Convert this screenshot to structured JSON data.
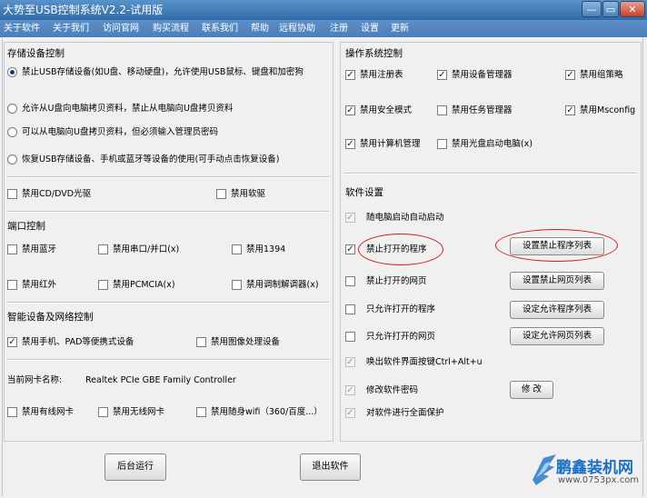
{
  "window": {
    "title": "大势至USB控制系统V2.2-试用版",
    "min_label": "—",
    "max_label": "▭",
    "close_label": "✕"
  },
  "menu": [
    "关于软件",
    "关于我们",
    "访问官网",
    "购买流程",
    "联系我们",
    "帮助",
    "远程协助",
    "注册",
    "设置",
    "更新"
  ],
  "storage": {
    "title": "存储设备控制",
    "radios": [
      {
        "label": "禁止USB存储设备(如U盘、移动硬盘)，允许使用USB鼠标、键盘和加密狗",
        "selected": true
      },
      {
        "label": "允许从U盘向电脑拷贝资料，禁止从电脑向U盘拷贝资料",
        "selected": false
      },
      {
        "label": "可以从电脑向U盘拷贝资料，但必须输入管理员密码",
        "selected": false
      },
      {
        "label": "恢复USB存储设备、手机或蓝牙等设备的使用(可手动点击恢复设备)",
        "selected": false
      }
    ],
    "cd_label": "禁用CD/DVD光驱",
    "floppy_label": "禁用软驱"
  },
  "port": {
    "title": "端口控制",
    "items": [
      "禁用蓝牙",
      "禁用串口/并口(x)",
      "禁用1394",
      "禁用红外",
      "禁用PCMCIA(x)",
      "禁用调制解调器(x)"
    ]
  },
  "smart": {
    "title": "智能设备及网络控制",
    "phone_label": "禁用手机、PAD等便携式设备",
    "image_label": "禁用图像处理设备",
    "nic_label": "当前网卡名称:",
    "nic_value": "Realtek PCIe GBE Family Controller",
    "wired_label": "禁用有线网卡",
    "wireless_label": "禁用无线网卡",
    "wifi_label": "禁用随身wifi（360/百度...）"
  },
  "os": {
    "title": "操作系统控制",
    "items": [
      {
        "label": "禁用注册表",
        "checked": true
      },
      {
        "label": "禁用设备管理器",
        "checked": true
      },
      {
        "label": "禁用组策略",
        "checked": true
      },
      {
        "label": "禁用安全模式",
        "checked": true
      },
      {
        "label": "禁用任务管理器",
        "checked": false
      },
      {
        "label": "禁用Msconfig",
        "checked": true
      },
      {
        "label": "禁用计算机管理",
        "checked": true
      },
      {
        "label": "禁用光盘启动电脑(x)",
        "checked": false
      }
    ]
  },
  "software": {
    "title": "软件设置",
    "items": [
      {
        "label": "随电脑启动自动启动",
        "checked": true
      },
      {
        "label": "禁止打开的程序",
        "checked": true
      },
      {
        "label": "禁止打开的网页",
        "checked": false
      },
      {
        "label": "只允许打开的程序",
        "checked": false
      },
      {
        "label": "只允许打开的网页",
        "checked": false
      },
      {
        "label": "唤出软件界面按键Ctrl+Alt+u",
        "checked": true
      },
      {
        "label": "修改软件密码",
        "checked": true
      },
      {
        "label": "对软件进行全面保护",
        "checked": true
      }
    ],
    "buttons": {
      "block_programs": "设置禁止程序列表",
      "block_pages": "设置禁止网页列表",
      "allow_programs": "设定允许程序列表",
      "allow_pages": "设定允许网页列表",
      "change_password": "修 改"
    }
  },
  "bottom": {
    "run_bg": "后台运行",
    "exit": "退出软件"
  },
  "watermark": {
    "brand": "鹏鑫装机网",
    "url": "www.0753px.com"
  },
  "colors": {
    "titlebar": "#2f6aa8",
    "menubar": "#4a7fbb",
    "highlight": "#d21b1b"
  }
}
